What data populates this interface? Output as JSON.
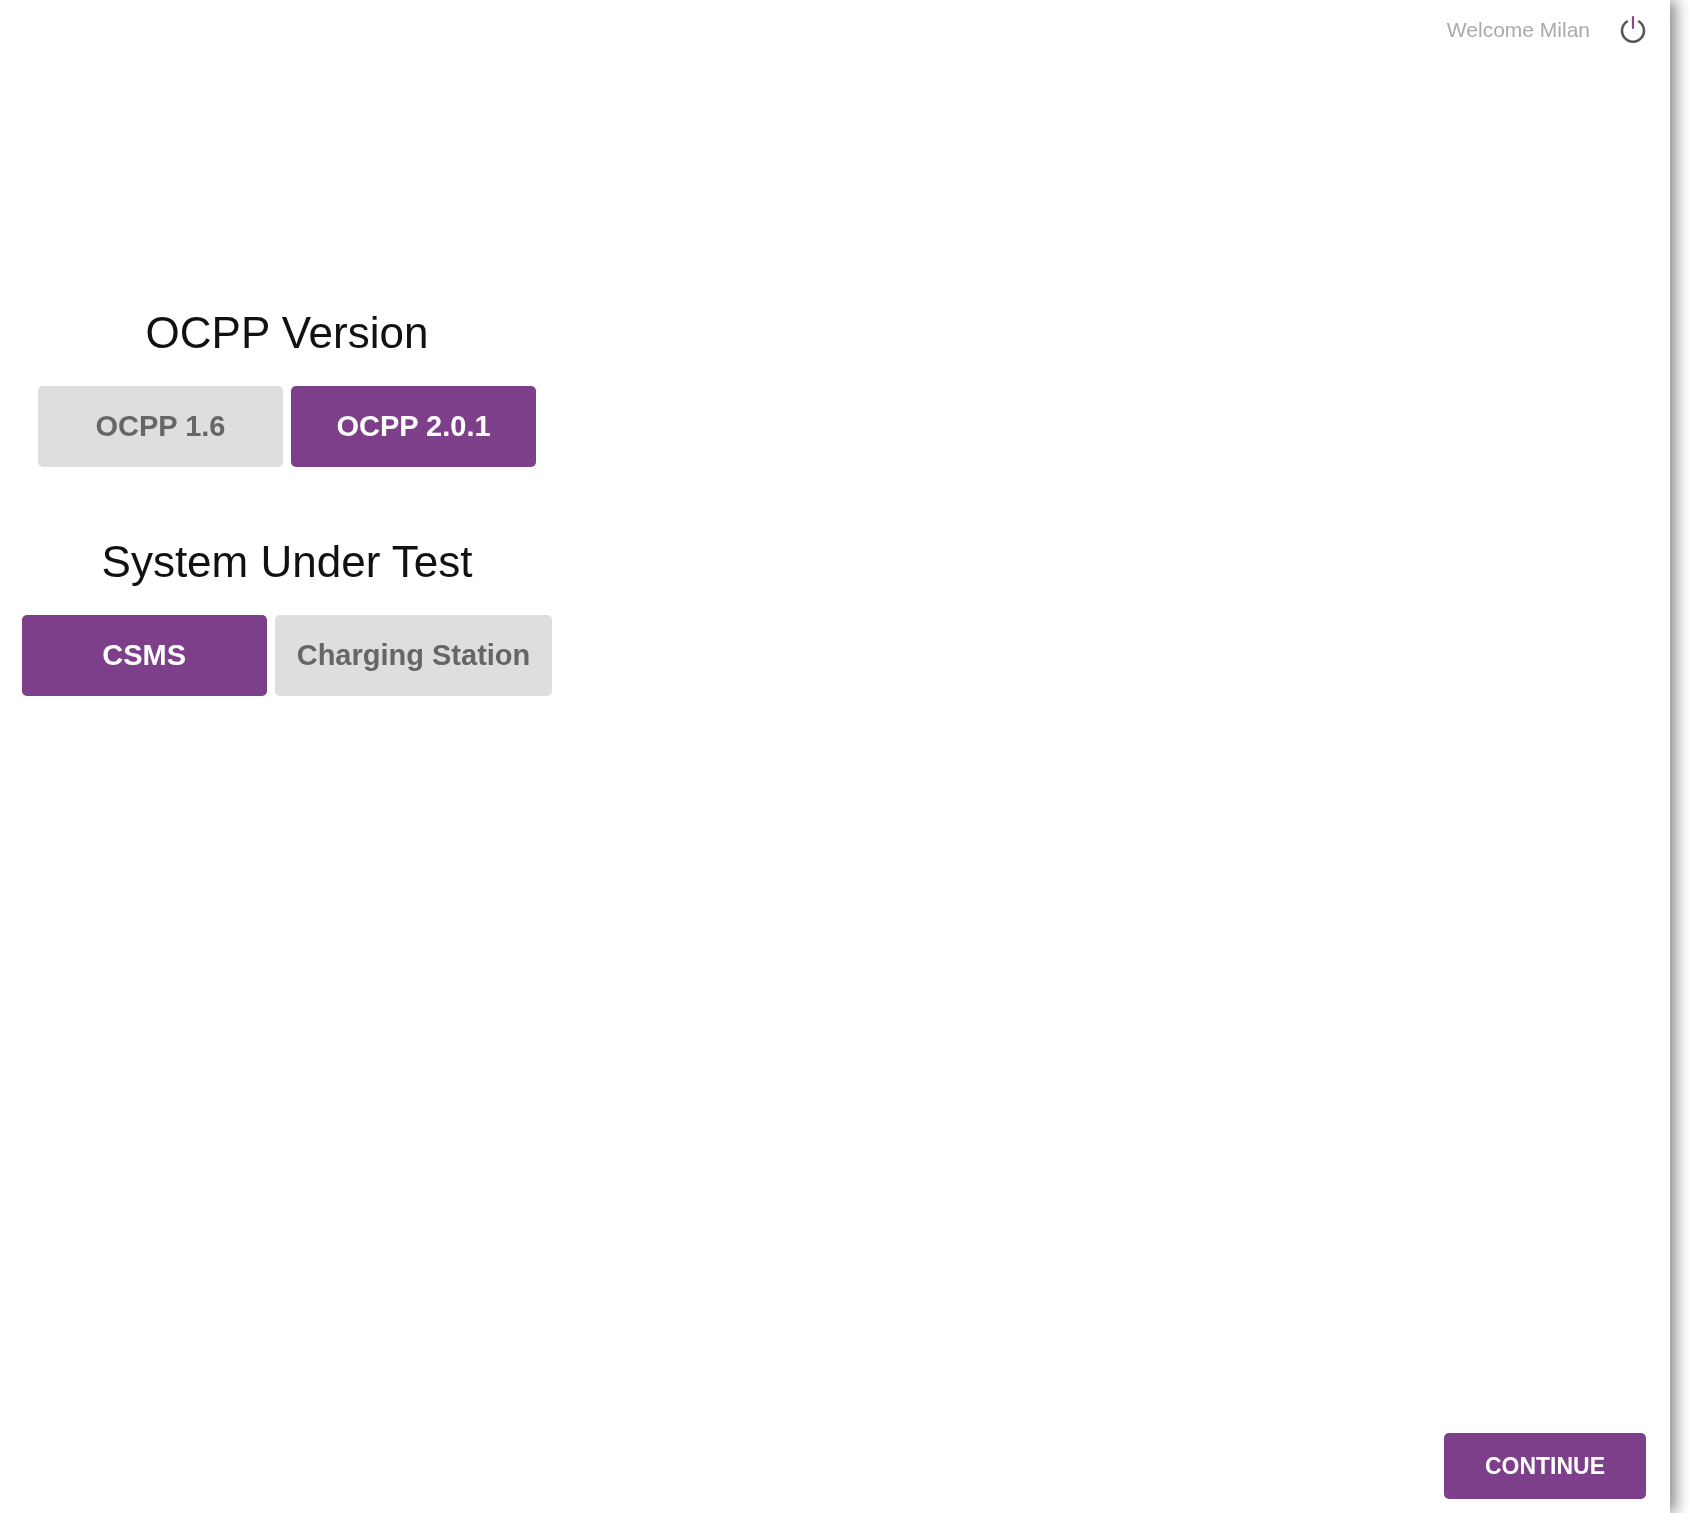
{
  "header": {
    "welcome": "Welcome Milan"
  },
  "sections": [
    {
      "title": "OCPP Version",
      "options": [
        {
          "label": "OCPP 1.6",
          "selected": false
        },
        {
          "label": "OCPP 2.0.1",
          "selected": true
        }
      ]
    },
    {
      "title": "System Under Test",
      "options": [
        {
          "label": "CSMS",
          "selected": true
        },
        {
          "label": "Charging Station",
          "selected": false
        }
      ]
    }
  ],
  "continue_button": "CONTINUE"
}
